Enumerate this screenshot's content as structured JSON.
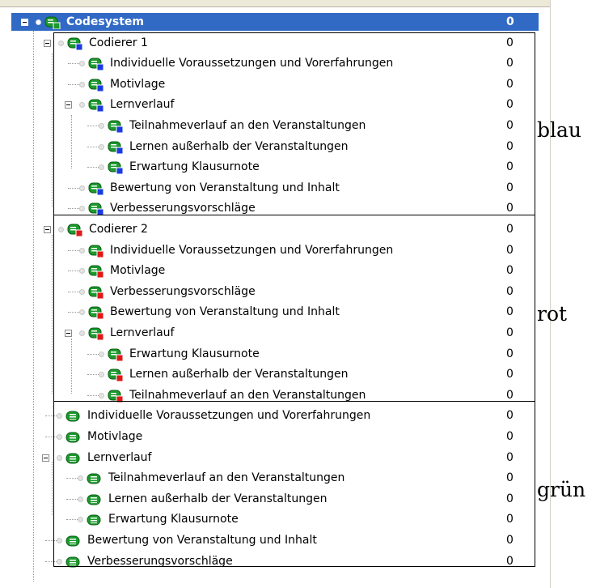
{
  "tree": {
    "root": {
      "label": "Codesystem",
      "count": "0"
    },
    "coder1": {
      "label": "Codierer 1",
      "count": "0",
      "color": "#1a3be0",
      "items": [
        {
          "label": "Individuelle Voraussetzungen und Vorerfahrungen",
          "count": "0"
        },
        {
          "label": "Motivlage",
          "count": "0"
        },
        {
          "label": "Lernverlauf",
          "count": "0"
        },
        {
          "label": "Teilnahmeverlauf an den Veranstaltungen",
          "count": "0"
        },
        {
          "label": "Lernen außerhalb der Veranstaltungen",
          "count": "0"
        },
        {
          "label": "Erwartung Klausurnote",
          "count": "0"
        },
        {
          "label": "Bewertung von Veranstaltung und Inhalt",
          "count": "0"
        },
        {
          "label": "Verbesserungsvorschläge",
          "count": "0"
        }
      ]
    },
    "coder2": {
      "label": "Codierer 2",
      "count": "0",
      "color": "#e01818",
      "items": [
        {
          "label": "Individuelle Voraussetzungen und Vorerfahrungen",
          "count": "0"
        },
        {
          "label": "Motivlage",
          "count": "0"
        },
        {
          "label": "Verbesserungsvorschläge",
          "count": "0"
        },
        {
          "label": "Bewertung von Veranstaltung und Inhalt",
          "count": "0"
        },
        {
          "label": "Lernverlauf",
          "count": "0"
        },
        {
          "label": "Erwartung Klausurnote",
          "count": "0"
        },
        {
          "label": "Lernen außerhalb der Veranstaltungen",
          "count": "0"
        },
        {
          "label": "Teilnahmeverlauf an den Veranstaltungen",
          "count": "0"
        }
      ]
    },
    "green": {
      "color": "#1b9a2c",
      "items": [
        {
          "label": "Individuelle Voraussetzungen und Vorerfahrungen",
          "count": "0"
        },
        {
          "label": "Motivlage",
          "count": "0"
        },
        {
          "label": "Lernverlauf",
          "count": "0"
        },
        {
          "label": "Teilnahmeverlauf an den Veranstaltungen",
          "count": "0"
        },
        {
          "label": "Lernen außerhalb der Veranstaltungen",
          "count": "0"
        },
        {
          "label": "Erwartung Klausurnote",
          "count": "0"
        },
        {
          "label": "Bewertung von Veranstaltung und Inhalt",
          "count": "0"
        },
        {
          "label": "Verbesserungsvorschläge",
          "count": "0"
        }
      ]
    }
  },
  "annotations": {
    "blue": "blau",
    "red": "rot",
    "green": "grün"
  },
  "colors": {
    "selection": "#316ac5",
    "code_icon": "#1b9a2c"
  }
}
